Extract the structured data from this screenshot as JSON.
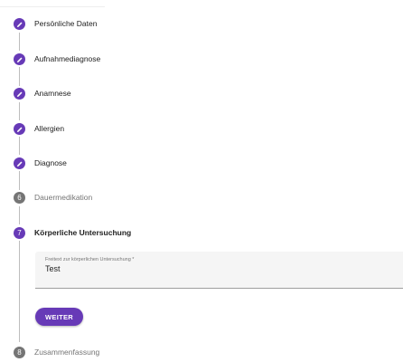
{
  "stepper": {
    "steps": [
      {
        "label": "Persönliche Daten",
        "state": "done",
        "icon": "pencil-icon"
      },
      {
        "label": "Aufnahmediagnose",
        "state": "done",
        "icon": "pencil-icon"
      },
      {
        "label": "Anamnese",
        "state": "done",
        "icon": "pencil-icon"
      },
      {
        "label": "Allergien",
        "state": "done",
        "icon": "pencil-icon"
      },
      {
        "label": "Diagnose",
        "state": "done",
        "icon": "pencil-icon"
      },
      {
        "label": "Dauermedikation",
        "state": "pending",
        "number": "6"
      },
      {
        "label": "Körperliche Untersuchung",
        "state": "active",
        "number": "7"
      },
      {
        "label": "Zusammenfassung",
        "state": "pending",
        "number": "8"
      }
    ]
  },
  "exam_field": {
    "label": "Freitext zur körperlichen Untersuchung *",
    "value": "Test"
  },
  "next_button": {
    "label": "WEITER"
  },
  "colors": {
    "accent": "#673ab7",
    "pending": "#757575"
  }
}
